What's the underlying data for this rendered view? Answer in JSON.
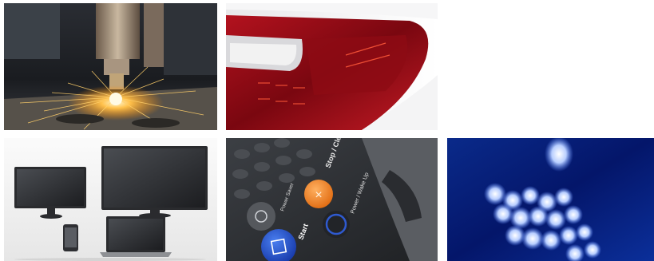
{
  "gallery": {
    "tiles": [
      {
        "icon": "laser-cutting-photo"
      },
      {
        "icon": "car-tail-light-photo"
      },
      {
        "icon": "monitors-devices-photo"
      },
      {
        "icon": "printer-control-panel-photo",
        "button_labels": {
          "stop": "Stop / Clear",
          "power": "Power / Wake Up",
          "start": "Start",
          "saver": "Power Saver"
        }
      },
      {
        "icon": "blue-led-lights-photo"
      }
    ]
  }
}
